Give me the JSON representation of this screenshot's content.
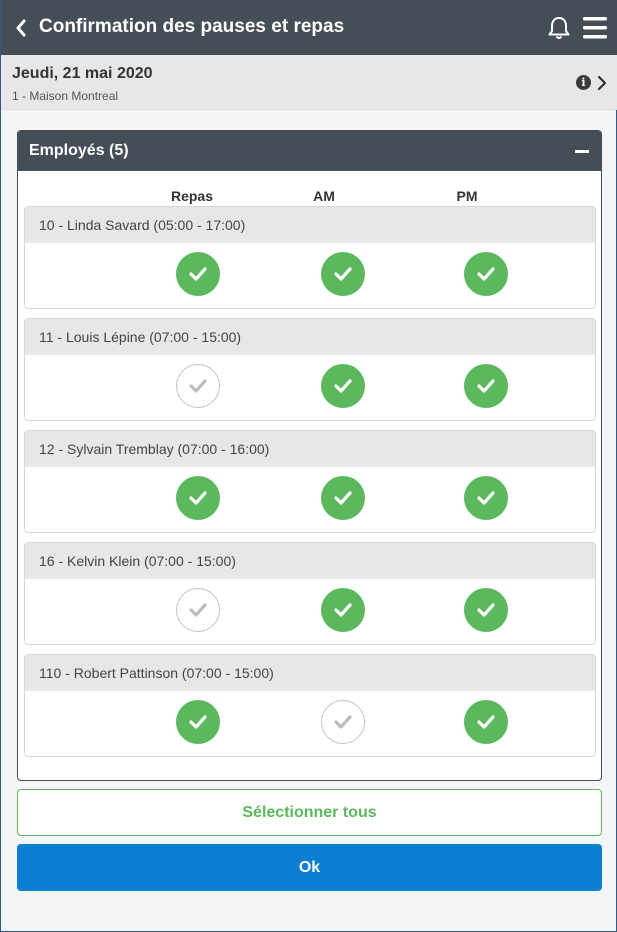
{
  "header": {
    "title": "Confirmation des pauses et repas",
    "back_icon": "chevron-left-icon",
    "bell_icon": "bell-icon",
    "menu_icon": "hamburger-menu-icon"
  },
  "datebar": {
    "date": "Jeudi, 21 mai 2020",
    "location": "1 - Maison Montreal",
    "info_glyph": "i"
  },
  "panel": {
    "title": "Employés (5)",
    "columns": [
      "Repas",
      "AM",
      "PM"
    ]
  },
  "employees": [
    {
      "label": "10 - Linda Savard (05:00 - 17:00)",
      "repas": true,
      "am": true,
      "pm": true
    },
    {
      "label": "11 - Louis Lépine (07:00 - 15:00)",
      "repas": false,
      "am": true,
      "pm": true
    },
    {
      "label": "12 - Sylvain Tremblay (07:00 - 16:00)",
      "repas": true,
      "am": true,
      "pm": true
    },
    {
      "label": "16 - Kelvin Klein (07:00 - 15:00)",
      "repas": false,
      "am": true,
      "pm": true
    },
    {
      "label": "110 - Robert Pattinson (07:00 - 15:00)",
      "repas": true,
      "am": false,
      "pm": true
    }
  ],
  "actions": {
    "select_all": "Sélectionner tous",
    "ok": "Ok"
  },
  "colors": {
    "topbar": "#454d56",
    "check_on": "#5cb85c",
    "primary": "#0a7fd4"
  }
}
